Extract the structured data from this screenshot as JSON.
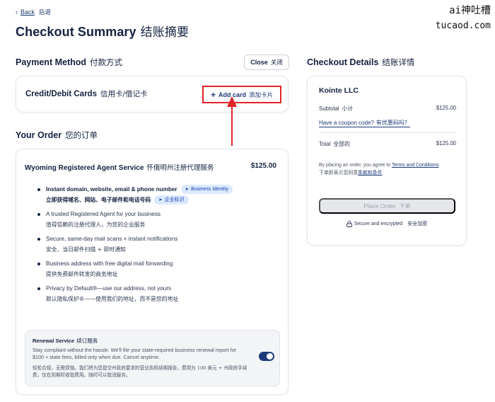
{
  "watermark": {
    "line1": "ai神吐槽",
    "line2": "tucaod.com"
  },
  "back": {
    "label": "Back",
    "label_zh": "后退"
  },
  "page_title": {
    "en": "Checkout Summary",
    "zh": "结账摘要"
  },
  "payment_method": {
    "heading": "Payment Method",
    "heading_zh": "付款方式",
    "close": "Close",
    "close_zh": "关闭",
    "card_label": "Credit/Debit Cards",
    "card_label_zh": "信用卡/借记卡",
    "add_card": "Add card",
    "add_card_zh": "添加卡片"
  },
  "your_order": {
    "heading": "Your Order",
    "heading_zh": "您的订单",
    "service_name": "Wyoming Registered Agent Service",
    "service_name_zh": "怀俄明州注册代理服务",
    "service_price": "$125.00",
    "features": [
      {
        "en": "Instant domain, website, email & phone number",
        "en_pill": "Business Identity",
        "zh": "立即获得域名、网站、电子邮件和电话号码",
        "zh_pill": "企业标识"
      },
      {
        "en": "A trusted Registered Agent for your business",
        "zh": "值得信赖的注册代理人，为您的企业服务"
      },
      {
        "en": "Secure, same-day mail scans + instant notifications",
        "zh": "安全、当日邮件扫描 + 即时通知"
      },
      {
        "en": "Business address with free digital mail forwarding",
        "zh": "提供免费邮件转发的商务地址"
      },
      {
        "en": "Privacy by Default®—use our address, not yours",
        "zh": "默认隐私保护®——使用我们的地址，而不是您的地址"
      }
    ],
    "renewal": {
      "title": "Renewal Service",
      "title_zh": "续订服务",
      "text_en": "Stay compliant without the hassle. We'll file your state-required business renewal report for $100 + state fees, billed only when due. Cancel anytime.",
      "text_zh": "轻松合规，无需烦恼。我们将为您提交州政府要求的营业执照续期报告，费用为 100 美元 + 州政府手续费，仅在到期时收取费用。随时可以取消服务。",
      "enabled": true
    }
  },
  "checkout_details": {
    "heading": "Checkout Details",
    "heading_zh": "结账详情",
    "vendor": "Kointe LLC",
    "subtotal_label": "Subtotal",
    "subtotal_label_zh": "小计",
    "subtotal_value": "$125.00",
    "coupon": "Have a coupon code?",
    "coupon_zh": "有优惠码吗？",
    "total_label": "Total",
    "total_label_zh": "全部的",
    "total_value": "$125.00",
    "terms_prefix": "By placing an order, you agree to",
    "terms_link": "Terms and Conditions",
    "terms_zh_prefix": "下单即表示您同意",
    "terms_zh_link": "条款和条件",
    "place_order": "Place Order",
    "place_order_zh": "下单",
    "secure": "Secure and encrypted",
    "secure_zh": "安全加密"
  },
  "colors": {
    "navy": "#13223f",
    "link": "#1d3b78",
    "annotation_red": "#e0242a",
    "pill_bg": "#dbeafe",
    "toggle_on": "#1d3b78"
  }
}
